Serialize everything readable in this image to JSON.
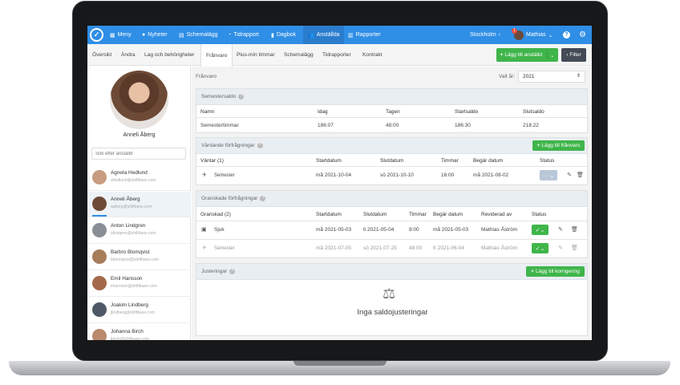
{
  "nav": {
    "menu": "Meny",
    "news": "Nyheter",
    "schedule": "Schemalägg",
    "time_report": "Tidrapport",
    "diary": "Dagbok",
    "staff": "Anställda",
    "reports": "Rapporter",
    "location": "Stockholm",
    "user": "Mathias",
    "badge": "1"
  },
  "tabs": [
    "Översikt",
    "Ändra",
    "Lag och behörigheter",
    "Frånvaro",
    "Plus-min timmar",
    "Schemalägg",
    "Tidrapporter",
    "Kontrakt"
  ],
  "actions": {
    "add_staff": "Lägg till anställd",
    "filter": "Filter"
  },
  "profile": {
    "name": "Anneli Åberg",
    "search_placeholder": "Sök efter anställd"
  },
  "people": [
    {
      "name": "Agneta Hedlund",
      "email": "ahedlund@shiftbase.com",
      "color": "#c79c80"
    },
    {
      "name": "Anneli Åberg",
      "email": "aaberg@shiftbase.com",
      "color": "#6e4b38"
    },
    {
      "name": "Anton Lindgren",
      "email": "alindgren@shiftbase.com",
      "color": "#8a8f96"
    },
    {
      "name": "Barbro Blomqvist",
      "email": "bblomqvist@shiftbase.com",
      "color": "#a77d5a"
    },
    {
      "name": "Emil Hansson",
      "email": "ehansson@shiftbase.com",
      "color": "#a4684a"
    },
    {
      "name": "Joakim Lindberg",
      "email": "jlindberg@shiftbase.com",
      "color": "#4f5866"
    },
    {
      "name": "Johanna Birch",
      "email": "jbirch@shiftbase.com",
      "color": "#b98a6c"
    }
  ],
  "page": {
    "title": "Frånvaro",
    "year_label": "Valt år:",
    "year": "2021"
  },
  "balance": {
    "title": "Semestersaldo",
    "headers": [
      "Namn",
      "Idag",
      "Tagen",
      "Startsaldo",
      "Slutsaldo"
    ],
    "row": [
      "Semestertimmar",
      "186:07",
      "48:00",
      "186:30",
      "218:22"
    ]
  },
  "pending": {
    "title": "Väntande förfrågningar",
    "add": "Lägg till frånvaro",
    "headers": [
      "Väntar (1)",
      "Startdatum",
      "Slutdatum",
      "Timmar",
      "Begär datum",
      "Status"
    ],
    "row": [
      "Semester",
      "må 2021-10-04",
      "sö 2021-10-10",
      "16:00",
      "må 2021-08-02"
    ]
  },
  "reviewed": {
    "title": "Granskade förfrågningar",
    "headers": [
      "Granskad (2)",
      "Startdatum",
      "Slutdatum",
      "Timmar",
      "Begär datum",
      "Reviderad av",
      "Status"
    ],
    "rows": [
      [
        "Sjuk",
        "må 2021-05-03",
        "ti 2021-05-04",
        "8:00",
        "må 2021-05-03",
        "Mathias Åström"
      ],
      [
        "Semester",
        "må 2021-07-05",
        "sö 2021-07-25",
        "48:00",
        "fr 2021-06-04",
        "Mathias Åström"
      ]
    ]
  },
  "adjust": {
    "title": "Justeringar",
    "add": "Lägg till korrigering",
    "empty": "Inga saldojusteringar"
  }
}
